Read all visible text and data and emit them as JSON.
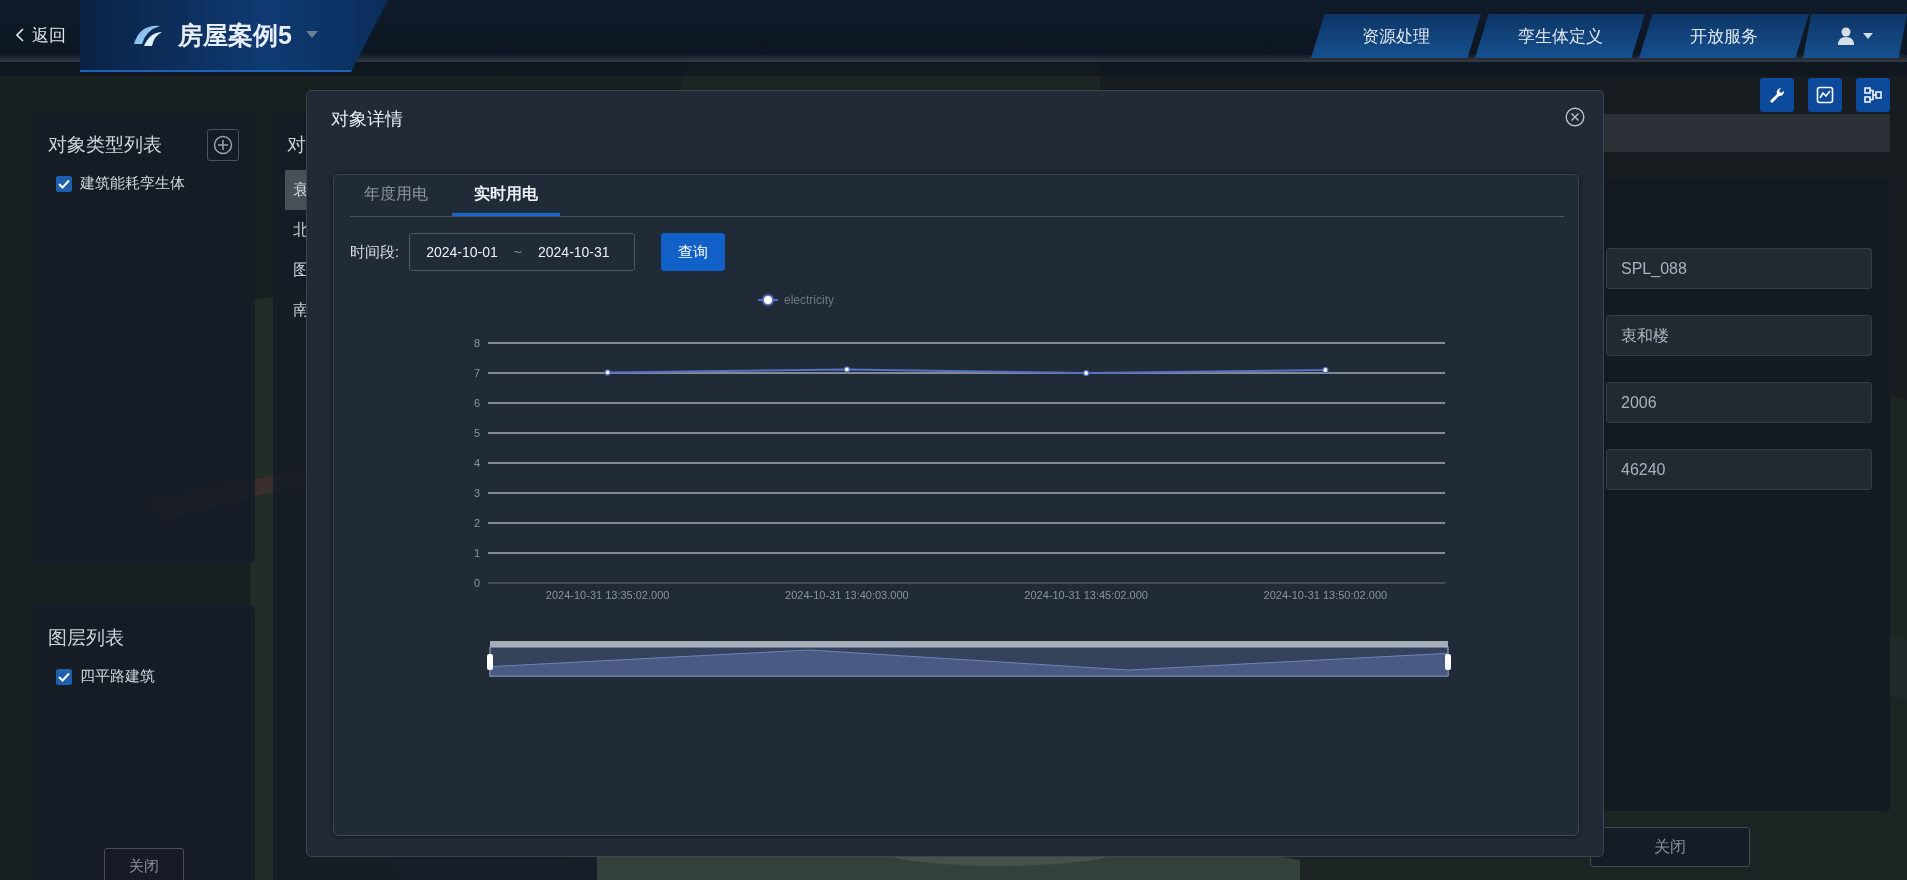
{
  "top_bar": {
    "back": "返回",
    "title": "房屋案例5",
    "nav_tabs": [
      {
        "label": "资源处理"
      },
      {
        "label": "孪生体定义"
      },
      {
        "label": "开放服务"
      }
    ]
  },
  "type_panel": {
    "title": "对象类型列表",
    "items": [
      {
        "label": "建筑能耗孪生体",
        "checked": true
      }
    ]
  },
  "layer_panel": {
    "title": "图层列表",
    "items": [
      {
        "label": "四平路建筑",
        "checked": true
      }
    ],
    "close": "关闭"
  },
  "object_panel": {
    "title": "对",
    "items": [
      {
        "label": "衰",
        "selected": true
      },
      {
        "label": "北",
        "selected": false
      },
      {
        "label": "图",
        "selected": false
      },
      {
        "label": "南",
        "selected": false
      }
    ]
  },
  "detail_panel": {
    "fields": [
      {
        "value": "SPL_088"
      },
      {
        "value": "衷和楼"
      },
      {
        "value": "2006"
      },
      {
        "value": "46240"
      }
    ],
    "close": "关闭"
  },
  "modal": {
    "title": "对象详情",
    "tabs": [
      {
        "label": "年度用电",
        "selected": false
      },
      {
        "label": "实时用电",
        "selected": true
      }
    ],
    "period_label": "时间段:",
    "start": "2024-10-01",
    "separator": "~",
    "end": "2024-10-31",
    "query": "查询",
    "chart_data": {
      "type": "line",
      "categories": [
        "2024-10-31 13:35:02.000",
        "2024-10-31 13:40:03.000",
        "2024-10-31 13:45:02.000",
        "2024-10-31 13:50:02.000"
      ],
      "series": [
        {
          "name": "electricity",
          "color": "#5470c6",
          "marker": "circle",
          "values": [
            7.02,
            7.12,
            7.0,
            7.1
          ]
        }
      ],
      "grid": true,
      "ylim": [
        0,
        8
      ],
      "yticks": [
        0,
        1,
        2,
        3,
        4,
        5,
        6,
        7,
        8
      ]
    }
  }
}
